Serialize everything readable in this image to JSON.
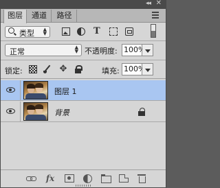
{
  "window": {
    "collapse_glyph": "◂◂",
    "close_glyph": "✕"
  },
  "tabs": [
    {
      "label": "图层",
      "active": true
    },
    {
      "label": "通道",
      "active": false
    },
    {
      "label": "路径",
      "active": false
    }
  ],
  "filter": {
    "kind_label": "类型",
    "icons": [
      "pixel-filter-icon",
      "adjustment-filter-icon",
      "type-filter-icon",
      "shape-filter-icon",
      "smart-object-filter-icon"
    ],
    "type_glyph": "T"
  },
  "blend": {
    "mode": "正常",
    "opacity_label": "不透明度:",
    "opacity_value": "100%"
  },
  "lock": {
    "label": "锁定:",
    "fill_label": "填充:",
    "fill_value": "100%",
    "move_glyph": "✥"
  },
  "layers": [
    {
      "name": "图层 1",
      "selected": true,
      "italic": false,
      "locked": false
    },
    {
      "name": "背景",
      "selected": false,
      "italic": true,
      "locked": true
    }
  ],
  "bottom_bar": {
    "fx_label": "fx",
    "icons": [
      "link-layers-icon",
      "fx-icon",
      "add-mask-icon",
      "adjustment-layer-icon",
      "new-group-icon",
      "new-layer-icon",
      "trash-icon"
    ]
  },
  "colors": {
    "selected_row": "#a9c6f1",
    "panel_bg": "#d6d6d6"
  }
}
